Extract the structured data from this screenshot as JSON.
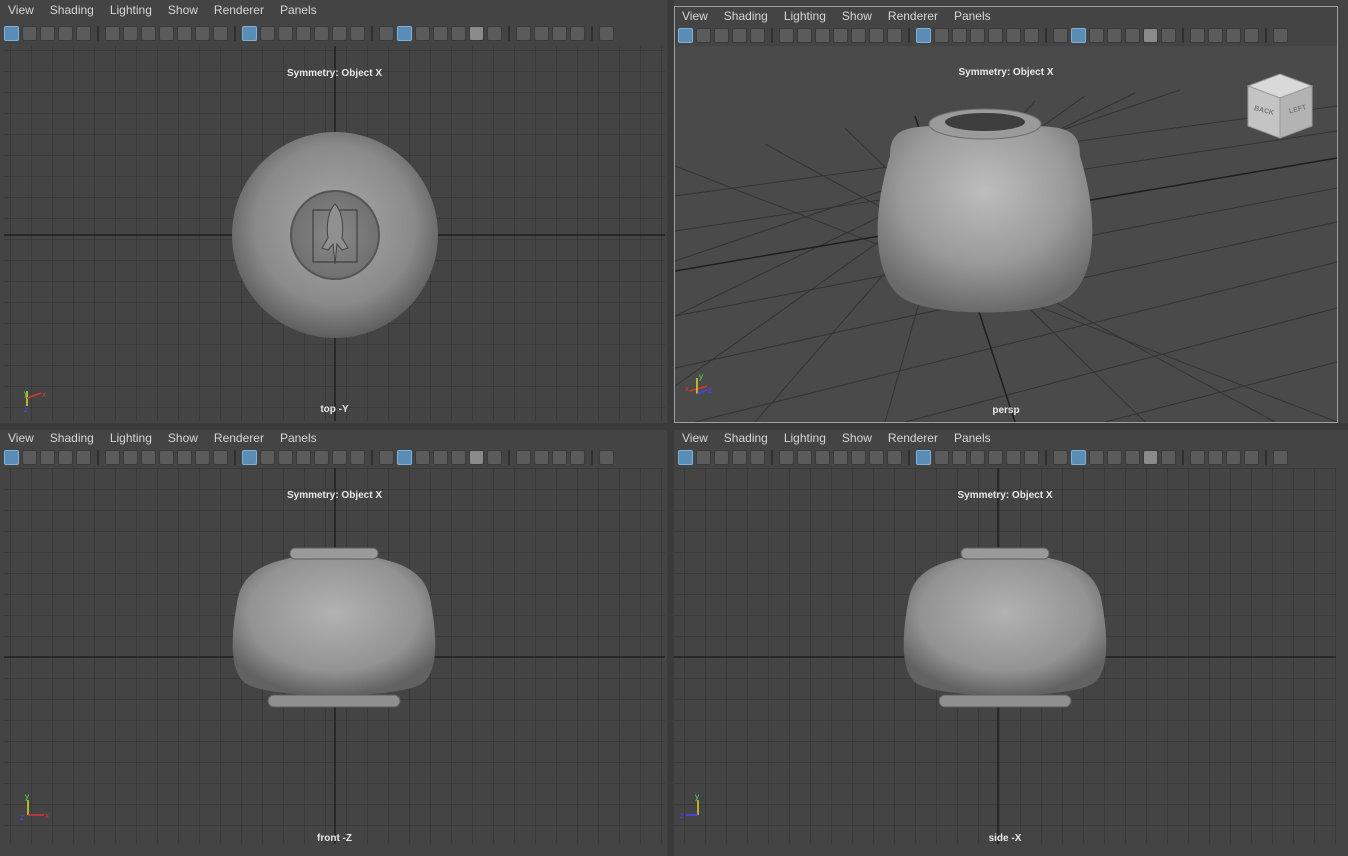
{
  "menu": [
    "View",
    "Shading",
    "Lighting",
    "Show",
    "Renderer",
    "Panels"
  ],
  "viewports": {
    "top": {
      "symmetry": "Symmetry: Object X",
      "camera": "top -Y"
    },
    "persp": {
      "symmetry": "Symmetry: Object X",
      "camera": "persp"
    },
    "front": {
      "symmetry": "Symmetry: Object X",
      "camera": "front -Z"
    },
    "side": {
      "symmetry": "Symmetry: Object X",
      "camera": "side -X"
    }
  },
  "view_cube": {
    "face1": "BACK",
    "face2": "LEFT"
  },
  "axis": {
    "x": "x",
    "y": "y",
    "z": "z"
  },
  "colors": {
    "background": "#444444",
    "grid": "#2b2b2b",
    "highlight": "#5a8db6"
  }
}
